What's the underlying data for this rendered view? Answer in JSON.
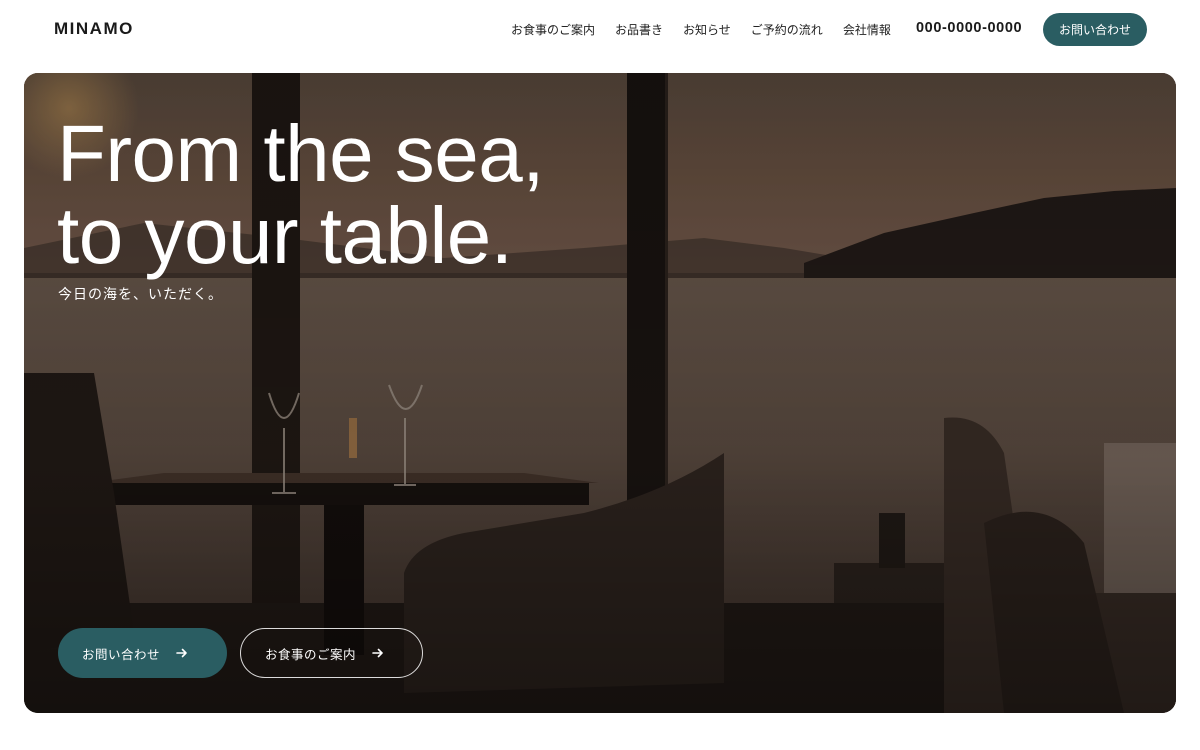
{
  "header": {
    "logo": "MINAMO",
    "nav": [
      "お食事のご案内",
      "お品書き",
      "お知らせ",
      "ご予約の流れ",
      "会社情報"
    ],
    "phone": "000-0000-0000",
    "cta_label": "お問い合わせ"
  },
  "hero": {
    "title_line1": "From the sea,",
    "title_line2": "to your table.",
    "subtitle": "今日の海を、いただく。",
    "primary_button": "お問い合わせ",
    "secondary_button": "お食事のご案内",
    "image_description_icon": "restaurant-seaview-photo"
  },
  "colors": {
    "accent": "#2a5d62",
    "white": "#ffffff",
    "text": "#1a1a1a"
  }
}
